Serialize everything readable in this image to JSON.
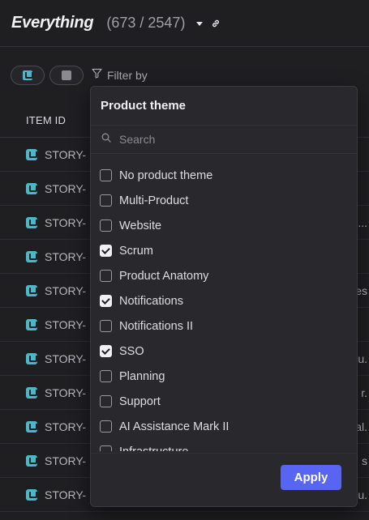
{
  "header": {
    "title": "Everything",
    "count": "(673 / 2547)"
  },
  "toolbar": {
    "filter_label": "Filter by"
  },
  "table": {
    "column_header": "ITEM ID",
    "rows": [
      {
        "id": "STORY-",
        "trail": ""
      },
      {
        "id": "STORY-",
        "trail": ""
      },
      {
        "id": "STORY-",
        "trail": "..."
      },
      {
        "id": "STORY-",
        "trail": ""
      },
      {
        "id": "STORY-",
        "trail": "es"
      },
      {
        "id": "STORY-",
        "trail": ""
      },
      {
        "id": "STORY-",
        "trail": "u."
      },
      {
        "id": "STORY-",
        "trail": "r."
      },
      {
        "id": "STORY-",
        "trail": "al."
      },
      {
        "id": "STORY-",
        "trail": "s"
      },
      {
        "id": "STORY-",
        "trail": "u."
      }
    ]
  },
  "dropdown": {
    "title": "Product theme",
    "search_placeholder": "Search",
    "options": [
      {
        "label": "No product theme",
        "checked": false
      },
      {
        "label": "Multi-Product",
        "checked": false
      },
      {
        "label": "Website",
        "checked": false
      },
      {
        "label": "Scrum",
        "checked": true
      },
      {
        "label": "Product Anatomy",
        "checked": false
      },
      {
        "label": "Notifications",
        "checked": true
      },
      {
        "label": "Notifications II",
        "checked": false
      },
      {
        "label": "SSO",
        "checked": true
      },
      {
        "label": "Planning",
        "checked": false
      },
      {
        "label": "Support",
        "checked": false
      },
      {
        "label": "AI Assistance Mark II",
        "checked": false
      },
      {
        "label": "Infrastructure",
        "checked": false
      }
    ],
    "apply_label": "Apply"
  },
  "colors": {
    "background": "#1f1f22",
    "accent": "#5865f2",
    "story_icon": "#4bb7c8"
  },
  "icons": {
    "caret": "caret-down-icon",
    "link": "link-icon",
    "story": "story-icon",
    "bug": "bug-icon",
    "filter": "filter-icon",
    "search": "search-icon"
  }
}
